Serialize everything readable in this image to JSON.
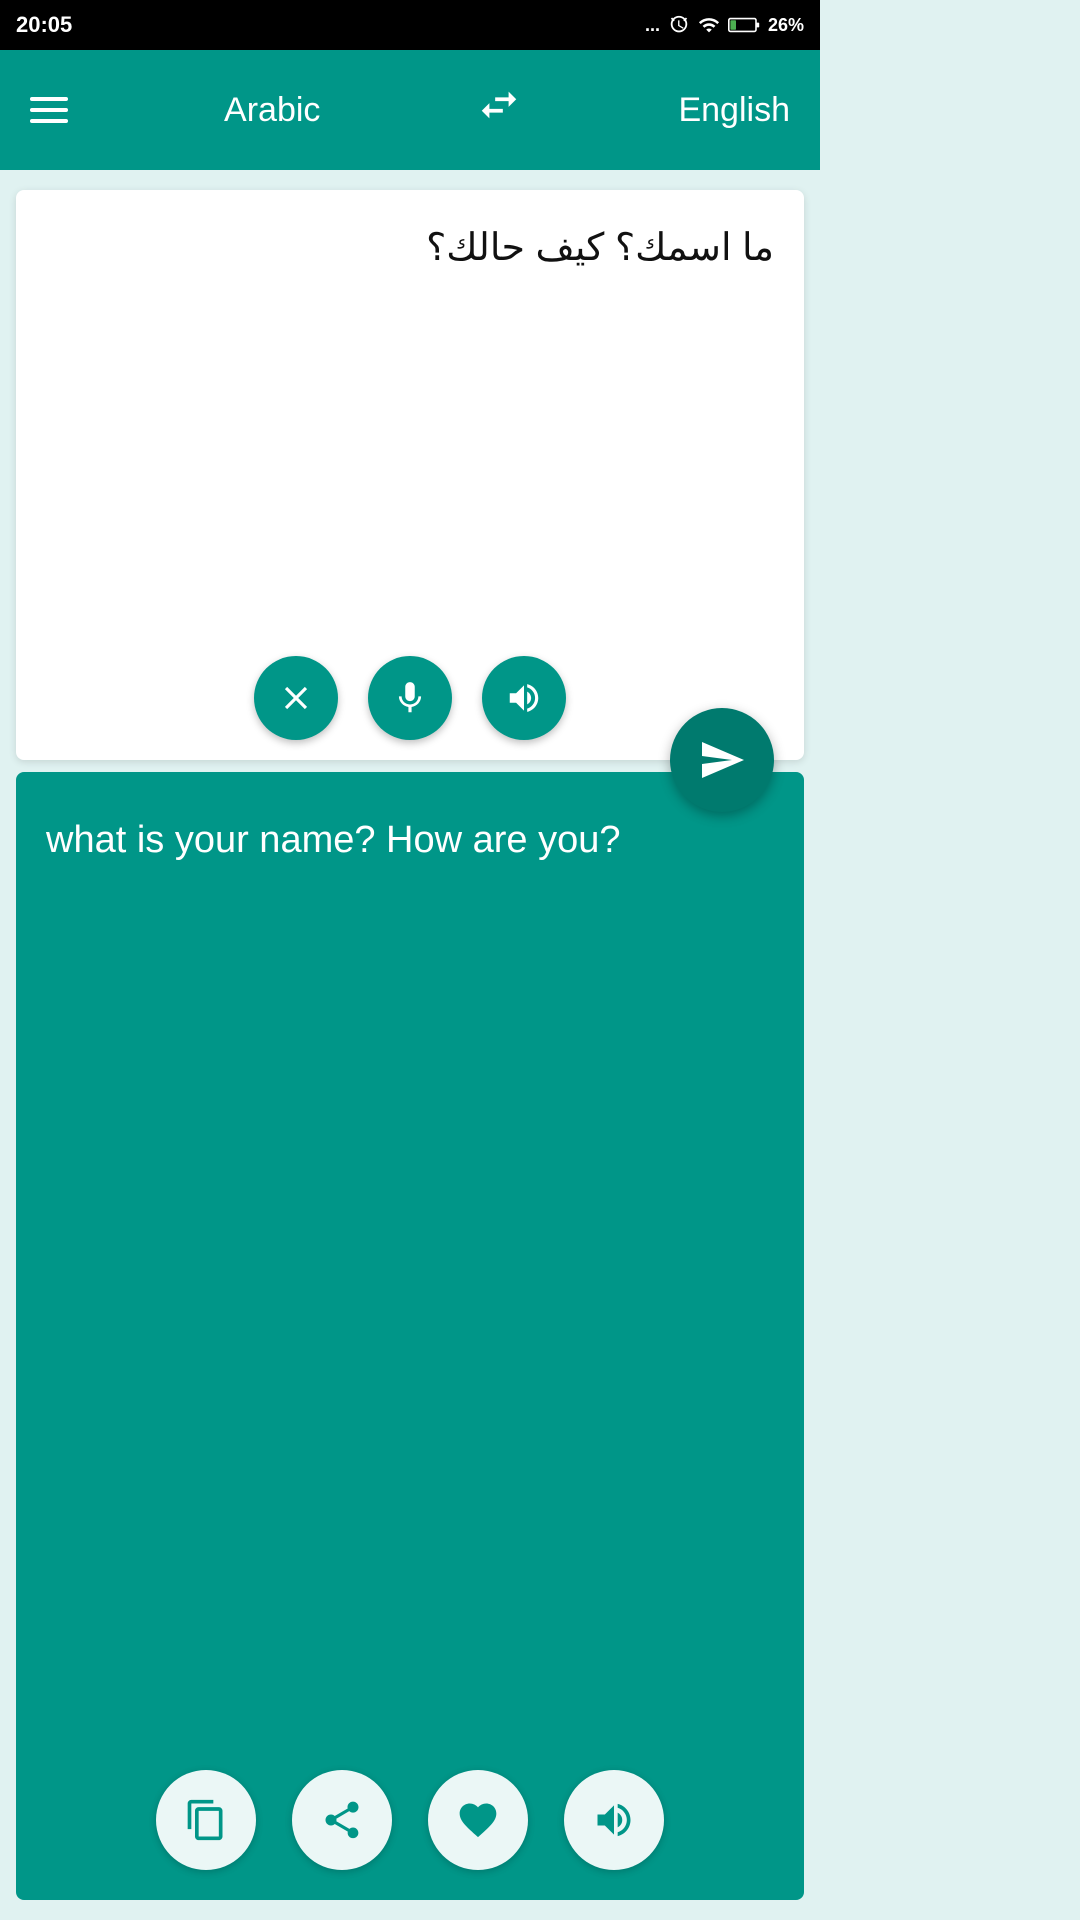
{
  "status_bar": {
    "time": "20:05",
    "dots": "...",
    "battery": "26%"
  },
  "header": {
    "menu_label": "menu",
    "source_lang": "Arabic",
    "swap_icon": "⇄",
    "target_lang": "English"
  },
  "input_panel": {
    "source_text": "ما اسمك؟ كيف حالك؟",
    "clear_label": "clear",
    "mic_label": "microphone",
    "speaker_label": "speaker"
  },
  "output_panel": {
    "translated_text": "what is your name? How are you?",
    "copy_label": "copy",
    "share_label": "share",
    "favorite_label": "favorite",
    "speaker_label": "speaker"
  },
  "send_button_label": "send"
}
